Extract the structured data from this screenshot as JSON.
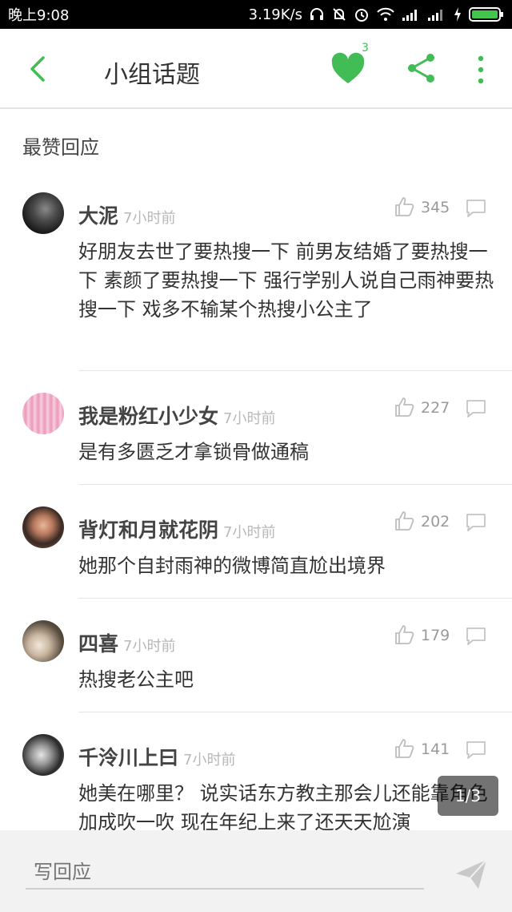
{
  "status_bar": {
    "time": "晚上9:08",
    "net_speed": "3.19K/s"
  },
  "app_bar": {
    "title": "小组话题",
    "favorite_count": "3",
    "accent_color": "#42bd56"
  },
  "section": {
    "title": "最赞回应"
  },
  "comments": [
    {
      "author": "大泥",
      "time": "7小时前",
      "likes": "345",
      "text": "好朋友去世了要热搜一下 前男友结婚了要热搜一下 素颜了要热搜一下 强行学别人说自己雨神要热搜一下 戏多不输某个热搜小公主了"
    },
    {
      "author": "我是粉红小少女",
      "time": "7小时前",
      "likes": "227",
      "text": "是有多匮乏才拿锁骨做通稿"
    },
    {
      "author": "背灯和月就花阴",
      "time": "7小时前",
      "likes": "202",
      "text": "她那个自封雨神的微博简直尬出境界"
    },
    {
      "author": "四喜",
      "time": "7小时前",
      "likes": "179",
      "text": "热搜老公主吧"
    },
    {
      "author": "千泠川上曰",
      "time": "7小时前",
      "likes": "141",
      "text": "她美在哪里？ 说实话东方教主那会儿还能靠角色加成吹一吹 现在年纪上来了还天天尬演"
    }
  ],
  "pager": "1/3",
  "reply_bar": {
    "placeholder": "写回应"
  }
}
